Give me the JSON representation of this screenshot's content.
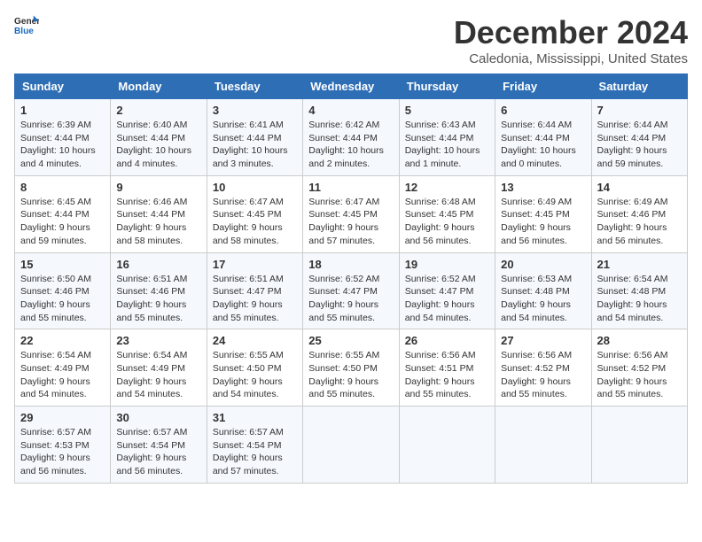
{
  "header": {
    "logo_general": "General",
    "logo_blue": "Blue",
    "title": "December 2024",
    "subtitle": "Caledonia, Mississippi, United States"
  },
  "weekdays": [
    "Sunday",
    "Monday",
    "Tuesday",
    "Wednesday",
    "Thursday",
    "Friday",
    "Saturday"
  ],
  "weeks": [
    [
      {
        "day": 1,
        "info": "Sunrise: 6:39 AM\nSunset: 4:44 PM\nDaylight: 10 hours\nand 4 minutes."
      },
      {
        "day": 2,
        "info": "Sunrise: 6:40 AM\nSunset: 4:44 PM\nDaylight: 10 hours\nand 4 minutes."
      },
      {
        "day": 3,
        "info": "Sunrise: 6:41 AM\nSunset: 4:44 PM\nDaylight: 10 hours\nand 3 minutes."
      },
      {
        "day": 4,
        "info": "Sunrise: 6:42 AM\nSunset: 4:44 PM\nDaylight: 10 hours\nand 2 minutes."
      },
      {
        "day": 5,
        "info": "Sunrise: 6:43 AM\nSunset: 4:44 PM\nDaylight: 10 hours\nand 1 minute."
      },
      {
        "day": 6,
        "info": "Sunrise: 6:44 AM\nSunset: 4:44 PM\nDaylight: 10 hours\nand 0 minutes."
      },
      {
        "day": 7,
        "info": "Sunrise: 6:44 AM\nSunset: 4:44 PM\nDaylight: 9 hours\nand 59 minutes."
      }
    ],
    [
      {
        "day": 8,
        "info": "Sunrise: 6:45 AM\nSunset: 4:44 PM\nDaylight: 9 hours\nand 59 minutes."
      },
      {
        "day": 9,
        "info": "Sunrise: 6:46 AM\nSunset: 4:44 PM\nDaylight: 9 hours\nand 58 minutes."
      },
      {
        "day": 10,
        "info": "Sunrise: 6:47 AM\nSunset: 4:45 PM\nDaylight: 9 hours\nand 58 minutes."
      },
      {
        "day": 11,
        "info": "Sunrise: 6:47 AM\nSunset: 4:45 PM\nDaylight: 9 hours\nand 57 minutes."
      },
      {
        "day": 12,
        "info": "Sunrise: 6:48 AM\nSunset: 4:45 PM\nDaylight: 9 hours\nand 56 minutes."
      },
      {
        "day": 13,
        "info": "Sunrise: 6:49 AM\nSunset: 4:45 PM\nDaylight: 9 hours\nand 56 minutes."
      },
      {
        "day": 14,
        "info": "Sunrise: 6:49 AM\nSunset: 4:46 PM\nDaylight: 9 hours\nand 56 minutes."
      }
    ],
    [
      {
        "day": 15,
        "info": "Sunrise: 6:50 AM\nSunset: 4:46 PM\nDaylight: 9 hours\nand 55 minutes."
      },
      {
        "day": 16,
        "info": "Sunrise: 6:51 AM\nSunset: 4:46 PM\nDaylight: 9 hours\nand 55 minutes."
      },
      {
        "day": 17,
        "info": "Sunrise: 6:51 AM\nSunset: 4:47 PM\nDaylight: 9 hours\nand 55 minutes."
      },
      {
        "day": 18,
        "info": "Sunrise: 6:52 AM\nSunset: 4:47 PM\nDaylight: 9 hours\nand 55 minutes."
      },
      {
        "day": 19,
        "info": "Sunrise: 6:52 AM\nSunset: 4:47 PM\nDaylight: 9 hours\nand 54 minutes."
      },
      {
        "day": 20,
        "info": "Sunrise: 6:53 AM\nSunset: 4:48 PM\nDaylight: 9 hours\nand 54 minutes."
      },
      {
        "day": 21,
        "info": "Sunrise: 6:54 AM\nSunset: 4:48 PM\nDaylight: 9 hours\nand 54 minutes."
      }
    ],
    [
      {
        "day": 22,
        "info": "Sunrise: 6:54 AM\nSunset: 4:49 PM\nDaylight: 9 hours\nand 54 minutes."
      },
      {
        "day": 23,
        "info": "Sunrise: 6:54 AM\nSunset: 4:49 PM\nDaylight: 9 hours\nand 54 minutes."
      },
      {
        "day": 24,
        "info": "Sunrise: 6:55 AM\nSunset: 4:50 PM\nDaylight: 9 hours\nand 54 minutes."
      },
      {
        "day": 25,
        "info": "Sunrise: 6:55 AM\nSunset: 4:50 PM\nDaylight: 9 hours\nand 55 minutes."
      },
      {
        "day": 26,
        "info": "Sunrise: 6:56 AM\nSunset: 4:51 PM\nDaylight: 9 hours\nand 55 minutes."
      },
      {
        "day": 27,
        "info": "Sunrise: 6:56 AM\nSunset: 4:52 PM\nDaylight: 9 hours\nand 55 minutes."
      },
      {
        "day": 28,
        "info": "Sunrise: 6:56 AM\nSunset: 4:52 PM\nDaylight: 9 hours\nand 55 minutes."
      }
    ],
    [
      {
        "day": 29,
        "info": "Sunrise: 6:57 AM\nSunset: 4:53 PM\nDaylight: 9 hours\nand 56 minutes."
      },
      {
        "day": 30,
        "info": "Sunrise: 6:57 AM\nSunset: 4:54 PM\nDaylight: 9 hours\nand 56 minutes."
      },
      {
        "day": 31,
        "info": "Sunrise: 6:57 AM\nSunset: 4:54 PM\nDaylight: 9 hours\nand 57 minutes."
      },
      null,
      null,
      null,
      null
    ]
  ]
}
